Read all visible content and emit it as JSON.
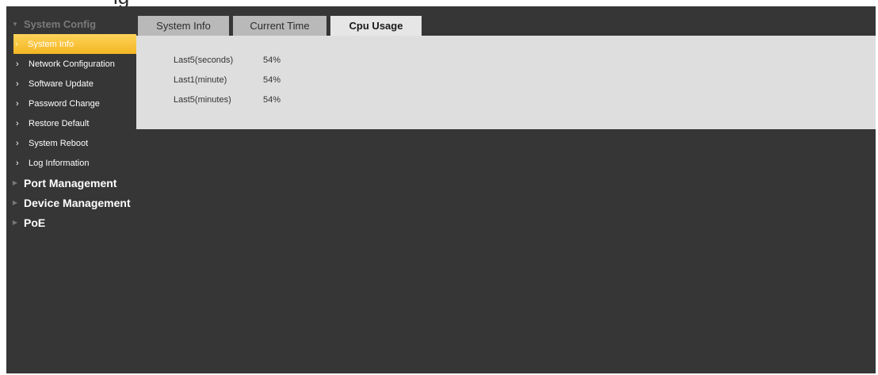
{
  "sidebar": {
    "groups": [
      {
        "label": "System Config",
        "expanded": true,
        "items": [
          {
            "label": "System Info",
            "active": true
          },
          {
            "label": "Network Configuration"
          },
          {
            "label": "Software Update"
          },
          {
            "label": "Password Change"
          },
          {
            "label": "Restore Default"
          },
          {
            "label": "System Reboot"
          },
          {
            "label": "Log Information"
          }
        ]
      },
      {
        "label": "Port Management",
        "expanded": false
      },
      {
        "label": "Device Management",
        "expanded": false
      },
      {
        "label": "PoE",
        "expanded": false
      }
    ]
  },
  "tabs": [
    {
      "label": "System Info"
    },
    {
      "label": "Current Time"
    },
    {
      "label": "Cpu Usage",
      "active": true
    }
  ],
  "cpu_usage": {
    "rows": [
      {
        "label": "Last5(seconds)",
        "value": "54%"
      },
      {
        "label": "Last1(minute)",
        "value": "54%"
      },
      {
        "label": "Last5(minutes)",
        "value": "54%"
      }
    ]
  },
  "colors": {
    "app_background": "#363636",
    "active_item": "#f3b622",
    "panel_background": "#dedede",
    "tab_inactive": "#b9b9b9",
    "tab_active": "#e6e6e6"
  }
}
